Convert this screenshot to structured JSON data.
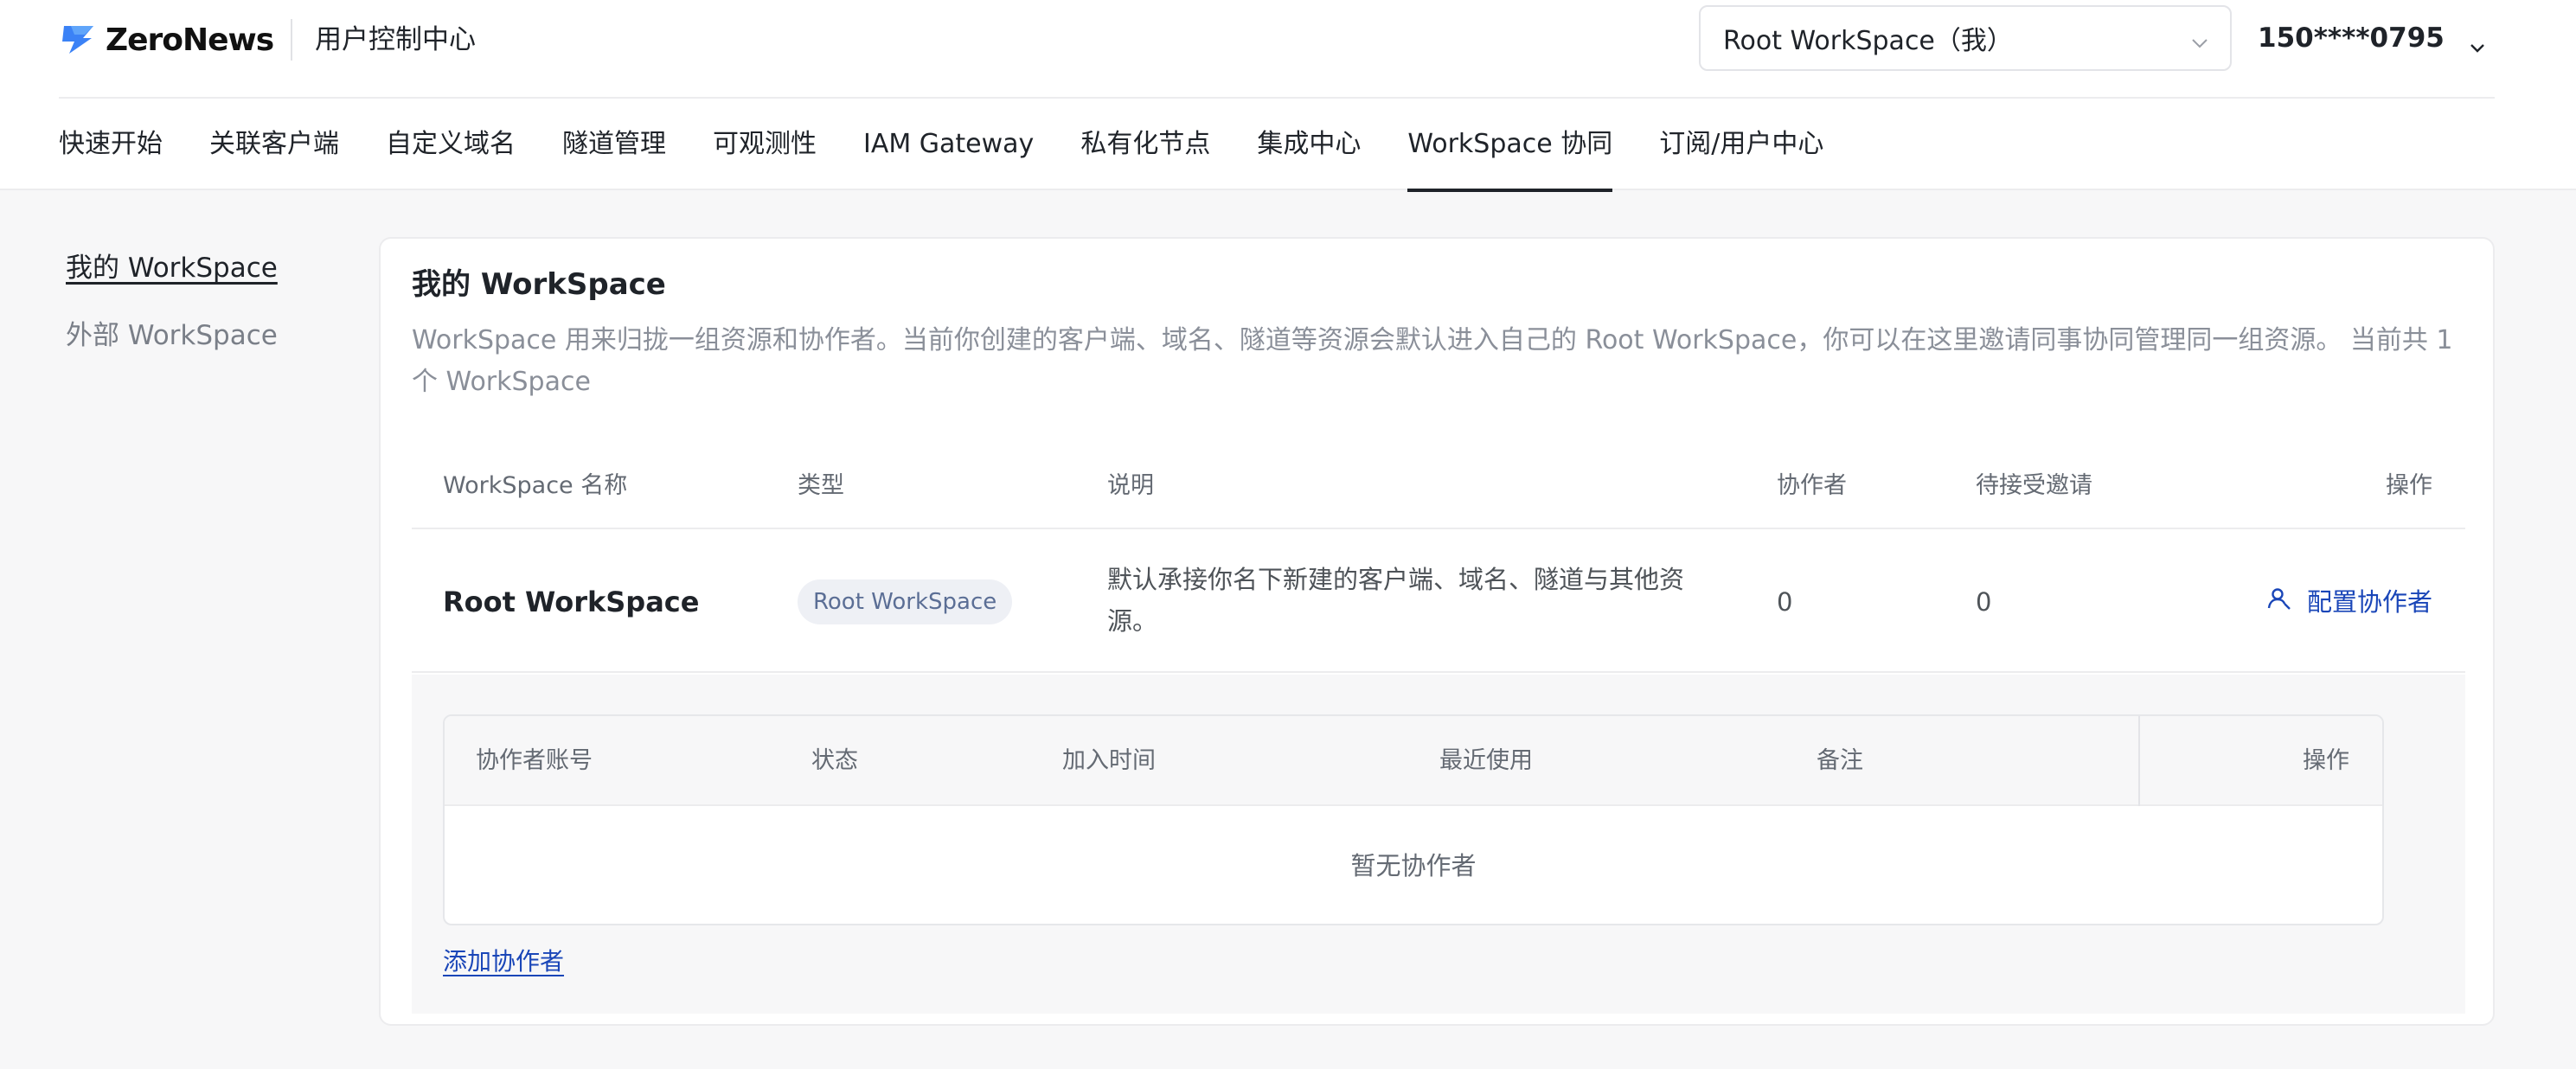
{
  "brand": {
    "name": "ZeroNews",
    "console_title": "用户控制中心"
  },
  "header": {
    "workspace_select": "Root WorkSpace（我）",
    "account": "150****0795"
  },
  "nav": [
    {
      "label": "快速开始"
    },
    {
      "label": "关联客户端"
    },
    {
      "label": "自定义域名"
    },
    {
      "label": "隧道管理"
    },
    {
      "label": "可观测性"
    },
    {
      "label": "IAM Gateway"
    },
    {
      "label": "私有化节点"
    },
    {
      "label": "集成中心"
    },
    {
      "label": "WorkSpace 协同",
      "active": true
    },
    {
      "label": "订阅/用户中心"
    }
  ],
  "sidebar": [
    {
      "label": "我的 WorkSpace",
      "active": true
    },
    {
      "label": "外部 WorkSpace",
      "active": false
    }
  ],
  "main": {
    "title": "我的 WorkSpace",
    "description": "WorkSpace 用来归拢一组资源和协作者。当前你创建的客户端、域名、隧道等资源会默认进入自己的 Root WorkSpace，你可以在这里邀请同事协同管理同一组资源。 当前共 1 个 WorkSpace",
    "columns": {
      "name": "WorkSpace 名称",
      "type": "类型",
      "desc": "说明",
      "collaborators": "协作者",
      "pending": "待接受邀请",
      "actions": "操作"
    },
    "rows": [
      {
        "name": "Root WorkSpace",
        "type": "Root WorkSpace",
        "desc": "默认承接你名下新建的客户端、域名、隧道与其他资源。",
        "collaborators": "0",
        "pending": "0",
        "action": "配置协作者"
      }
    ],
    "collaborator_table": {
      "columns": {
        "account": "协作者账号",
        "status": "状态",
        "joined": "加入时间",
        "last_used": "最近使用",
        "note": "备注",
        "actions": "操作"
      },
      "empty_text": "暂无协作者",
      "add_label": "添加协作者"
    }
  },
  "colors": {
    "accent": "#1a46b8",
    "page_bg": "#f7f7f8",
    "badge_bg": "#eef0f5",
    "badge_text": "#5b6e95",
    "logo_blue": "#3b82f6"
  }
}
